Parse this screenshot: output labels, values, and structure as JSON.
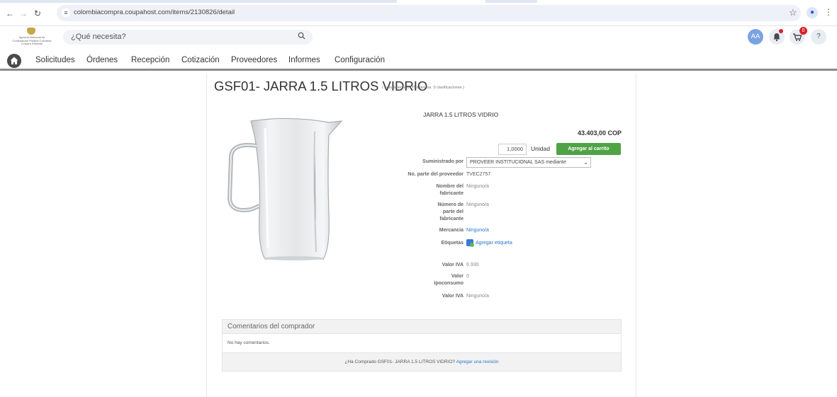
{
  "browser": {
    "url": "colombiacompra.coupahost.com/items/2130826/detail"
  },
  "header": {
    "logo_text": "Agencia Nacional de Contratación Pública Colombia Compra Eficiente",
    "search_placeholder": "¿Qué necesita?",
    "avatar_initials": "AA",
    "cart_count": "0",
    "help_label": "?"
  },
  "nav": {
    "items": [
      "Solicitudes",
      "Órdenes",
      "Recepción",
      "Cotización",
      "Proveedores",
      "Informes",
      "Configuración"
    ]
  },
  "item": {
    "title": "GSF01- JARRA 1.5 LITROS VIDRIO",
    "rating_note": "( Actualmente 0.0/5 estrellas. 0 clasificaciones )",
    "name": "JARRA 1.5 LITROS VIDRIO",
    "price": "43.403,00 COP",
    "quantity": "1,0000",
    "unit": "Unidad",
    "add_to_cart": "Agregar al carrito",
    "supplier_label": "Suministrado por",
    "supplier_value": "PROVEER INSTITUCIONAL SAS mediante",
    "part_no_label": "No. parte del proveedor",
    "part_no_value": "TVEC2757",
    "manufacturer_label": "Nombre del fabricante",
    "manufacturer_value": "Ninguno/a",
    "mfr_part_label": "Número de parte del fabricante",
    "mfr_part_value": "Ninguno/a",
    "commodity_label": "Mercancía",
    "commodity_value": "Ninguno/a",
    "tags_label": "Etiquetas",
    "tags_value": "Agregar etiqueta",
    "iva_label": "Valor IVA",
    "iva_value": "6.930",
    "ipoconsumo_label": "Valor Ipoconsumo",
    "ipoconsumo_value": "0",
    "iva2_label": "Valor IVA",
    "iva2_value": "Ninguno/a"
  },
  "comments": {
    "header": "Comentarios del comprador",
    "empty": "No hay comentarios.",
    "question": "¿Ha Comprado GSF01- JARRA 1.5 LITROS VIDRIO?",
    "review_link": "Agregar una revisión"
  }
}
